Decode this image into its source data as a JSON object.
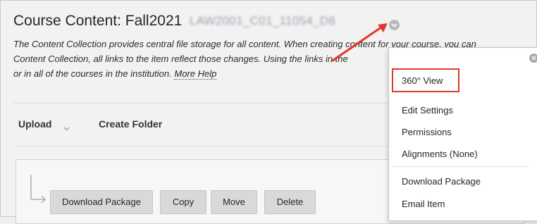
{
  "page": {
    "title": "Course Content: Fall2021",
    "title_redacted": "LAW2001_C01_11054_D8",
    "description_lines": [
      "The Content Collection provides central file storage for all content. When creating content for your course, you can",
      "Content Collection, all links to the item reflect those changes. Using the links in the",
      "or in all of the courses in the institution."
    ],
    "more_help": "More Help"
  },
  "toolbar": {
    "upload_label": "Upload",
    "create_folder_label": "Create Folder"
  },
  "actions": {
    "download_package": "Download Package",
    "copy": "Copy",
    "move": "Move",
    "delete": "Delete"
  },
  "context_menu": {
    "items": [
      "360° View",
      "Edit Settings",
      "Permissions",
      "Alignments (None)",
      "Download Package",
      "Email Item"
    ],
    "highlighted_item": "360° View"
  },
  "colors": {
    "annotation_red": "#e0392b",
    "menu_bg": "#ffffff",
    "page_bg": "#f2f2f2",
    "button_bg": "#d9d9d9"
  },
  "icons": {
    "title_menu": "chevron-down-icon",
    "menu_close": "close-icon",
    "upload_caret": "chevron-down-icon",
    "selection_arrow": "corner-arrow-icon",
    "annotation": "red-arrow-icon"
  }
}
